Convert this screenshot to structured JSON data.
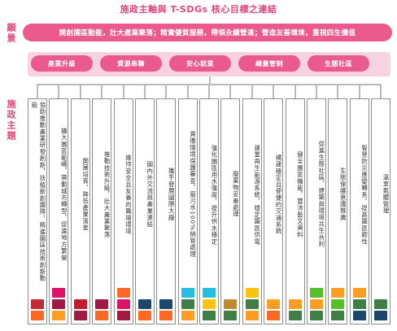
{
  "title": "施政主軸與 T-SDGs 核心目標之連結",
  "vision": {
    "label": "願景",
    "text": "開創園區動能，壯大產業聚落；精實優質服務，帶領永續營運；營造友善環境，重視四生價值"
  },
  "strategies": [
    "產業升級",
    "資源串聯",
    "安心就業",
    "總量管制",
    "生態社區"
  ],
  "themes_label": "施政主題",
  "themes": [
    {
      "text": "協助推動產業研發創新，扶植新創團隊，精進園區技術創新動能",
      "sdgs": [
        "#c22a38",
        "#fd6925"
      ]
    },
    {
      "text": "擴大園區範疇，帶動城市轉型，促進地方繁榮",
      "sdgs": [
        "#dd1367",
        "#a21942",
        "#fd9d24"
      ]
    },
    {
      "text": "開展培育，降低產業落差",
      "sdgs": [
        "#c5192d",
        "#a21942"
      ]
    },
    {
      "text": "推動技術升級，壯大產業聚落",
      "sdgs": [
        "#a21942",
        "#fd6925"
      ]
    },
    {
      "text": "維持安全且友善的職場環境",
      "sdgs": [
        "#fd6925",
        "#dd1367",
        "#a21942"
      ]
    },
    {
      "text": "國內外交流與產業連結",
      "sdgs": [
        "#19486a",
        "#fd6925"
      ]
    },
    {
      "text": "攜手發展國際大廠",
      "sdgs": [
        "#19486a",
        "#fd6925"
      ]
    },
    {
      "text": "貫徹環境保護審查，廢污水100%納管處理",
      "sdgs": [
        "#26bde2",
        "#3f7e44",
        "#fd9d24"
      ]
    },
    {
      "text": "強化園區用水強度，提升供水穩定",
      "sdgs": [
        "#26bde2",
        "#fcc30b",
        "#3f7e44"
      ]
    },
    {
      "text": "廢棄物妥善處理",
      "sdgs": [
        "#bf8b2e",
        "#3f7e44"
      ]
    },
    {
      "text": "建置再生能源系統，穩定園區供電",
      "sdgs": [
        "#fcc30b",
        "#3f7e44",
        "#fd9d24"
      ]
    },
    {
      "text": "構建穩定且便捷的交通系統",
      "sdgs": [
        "#fd9d24",
        "#fd6925"
      ]
    },
    {
      "text": "健全園區機能，豐沛藝文資料",
      "sdgs": [
        "#fd9d24",
        "#3f7e44"
      ]
    },
    {
      "text": "促進生態社區，建築與環境共生共利",
      "sdgs": [
        "#56c02b",
        "#fd9d24",
        "#3f7e44"
      ]
    },
    {
      "text": "生態保護意識推廣",
      "sdgs": [
        "#fd9d24",
        "#56c02b",
        "#3f7e44"
      ]
    },
    {
      "text": "智慧防災應變轉系，提高園區韌性",
      "sdgs": [
        "#fd9d24",
        "#3f7e44",
        "#19486a"
      ]
    },
    {
      "text": "溫室氣體管理",
      "sdgs": [
        "#3f7e44",
        "#19486a"
      ]
    }
  ]
}
